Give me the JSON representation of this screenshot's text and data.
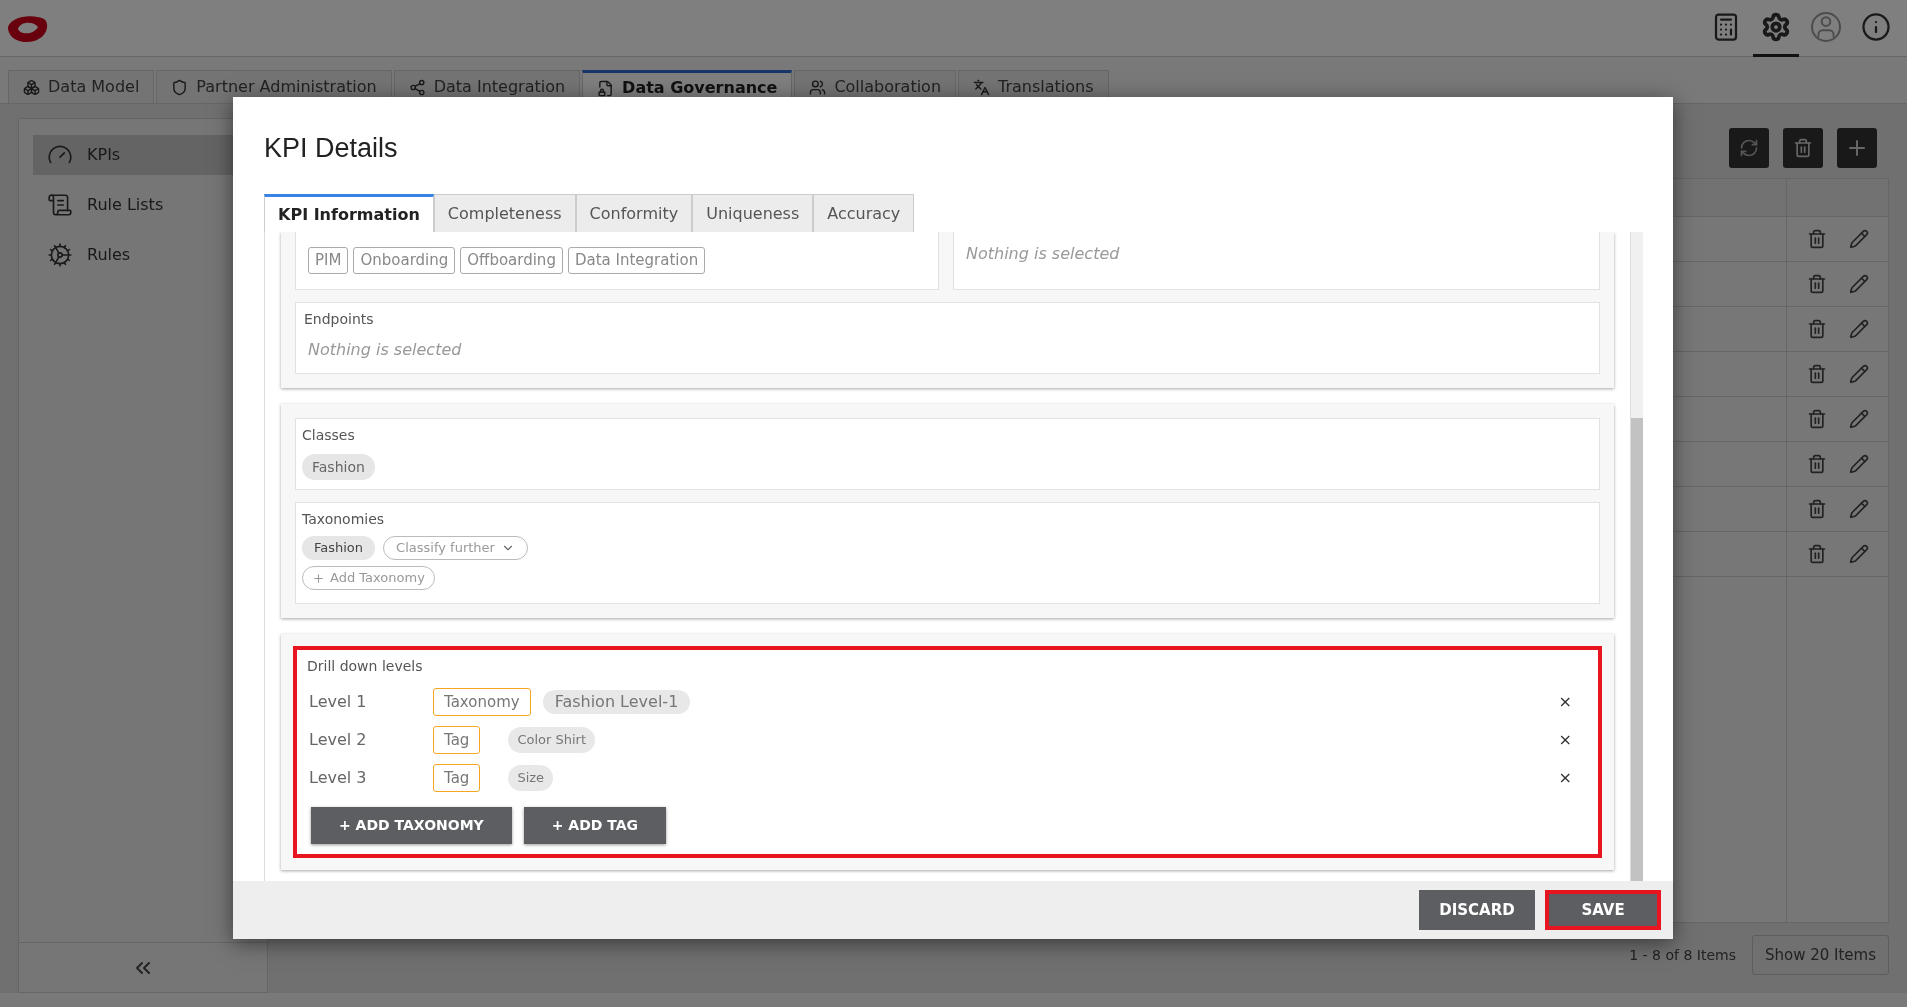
{
  "header_buttons": [
    {
      "kind": "device",
      "selected": false
    },
    {
      "kind": "settings",
      "selected": true
    },
    {
      "kind": "user",
      "selected": false
    },
    {
      "kind": "info",
      "selected": false
    }
  ],
  "app_tabs": [
    {
      "label": "Data Model",
      "kind": "model",
      "selected": false
    },
    {
      "label": "Partner Administration",
      "kind": "shield",
      "selected": false
    },
    {
      "label": "Data Integration",
      "kind": "integration",
      "selected": false
    },
    {
      "label": "Data Governance",
      "kind": "governance",
      "selected": true
    },
    {
      "label": "Collaboration",
      "kind": "collaboration",
      "selected": false
    },
    {
      "label": "Translations",
      "kind": "translations",
      "selected": false
    }
  ],
  "sidebar": {
    "items": [
      {
        "label": "KPIs",
        "kind": "gauge",
        "selected": true
      },
      {
        "label": "Rule Lists",
        "kind": "list",
        "selected": false
      },
      {
        "label": "Rules",
        "kind": "rules",
        "selected": false
      }
    ]
  },
  "table": {
    "rows": [
      {
        "kind": "actions"
      },
      {
        "kind": "actions"
      },
      {
        "kind": "actions"
      },
      {
        "kind": "actions"
      },
      {
        "kind": "actions"
      },
      {
        "kind": "actions"
      },
      {
        "kind": "actions"
      },
      {
        "kind": "actions"
      }
    ]
  },
  "pagination": {
    "summary": "1 - 8 of 8 Items",
    "page_size_button": "Show 20 Items"
  },
  "modal": {
    "title": "KPI Details",
    "tabs": [
      {
        "label": "KPI Information",
        "selected": true
      },
      {
        "label": "Completeness",
        "selected": false
      },
      {
        "label": "Conformity",
        "selected": false
      },
      {
        "label": "Uniqueness",
        "selected": false
      },
      {
        "label": "Accuracy",
        "selected": false
      }
    ],
    "scope_chips": [
      "PIM",
      "Onboarding",
      "Offboarding",
      "Data Integration"
    ],
    "side_box": {
      "empty_text": "Nothing is selected"
    },
    "endpoints": {
      "label": "Endpoints",
      "empty_text": "Nothing is selected"
    },
    "classes": {
      "label": "Classes",
      "chips": [
        "Fashion"
      ]
    },
    "taxonomies": {
      "label": "Taxonomies",
      "chips": [
        "Fashion"
      ],
      "classify_button": "Classify further",
      "add_button": "Add Taxonomy"
    },
    "drill_down": {
      "label": "Drill down levels",
      "highlighted": true,
      "levels": [
        {
          "label": "Level 1",
          "kind": "taxonomy",
          "type": "Taxonomy",
          "value": "Fashion Level-1",
          "remove": "×"
        },
        {
          "label": "Level 2",
          "kind": "tag",
          "type": "Tag",
          "value": "Color Shirt",
          "remove": "×"
        },
        {
          "label": "Level 3",
          "kind": "tag",
          "type": "Tag",
          "value": "Size",
          "remove": "×"
        }
      ],
      "buttons": [
        "+ ADD TAXONOMY",
        "+ ADD TAG"
      ]
    },
    "footer": {
      "buttons": [
        {
          "label": "DISCARD",
          "highlighted": false
        },
        {
          "label": "SAVE",
          "highlighted": true
        }
      ]
    }
  }
}
